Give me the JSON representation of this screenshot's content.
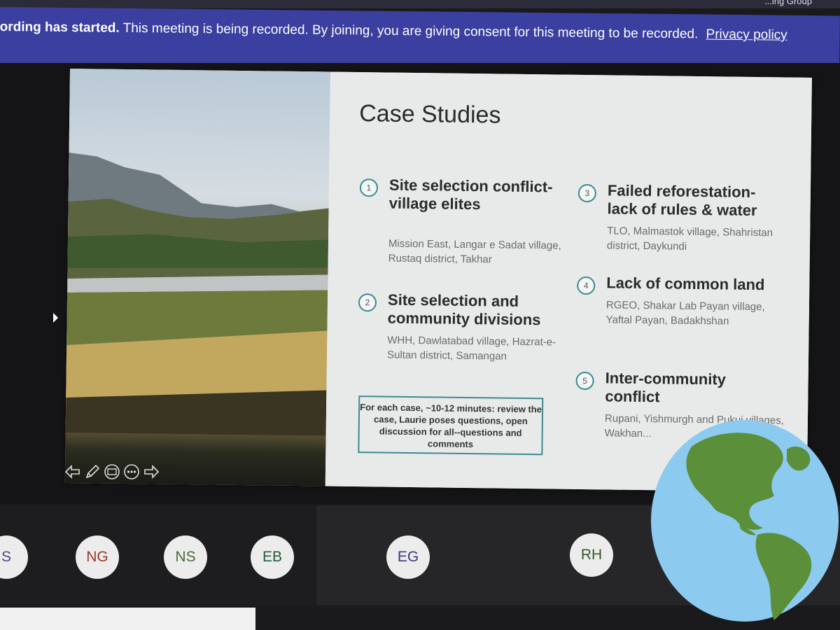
{
  "meeting": {
    "group_label": "...ing Group",
    "recording_banner": {
      "bold": "ording has started.",
      "message": "This meeting is being recorded. By joining, you are giving consent for this meeting to be recorded.",
      "link": "Privacy policy"
    }
  },
  "slide": {
    "title": "Case Studies",
    "cases": [
      {
        "number": "1",
        "title": "Site selection conflict- village elites",
        "subtitle": "Mission East, Langar e Sadat village, Rustaq district, Takhar"
      },
      {
        "number": "2",
        "title": "Site selection and community divisions",
        "subtitle": "WHH, Dawlatabad village, Hazrat-e-Sultan district, Samangan"
      },
      {
        "number": "3",
        "title": "Failed reforestation- lack of rules & water",
        "subtitle": "TLO, Malmastok village, Shahristan district, Daykundi"
      },
      {
        "number": "4",
        "title": "Lack of common land",
        "subtitle": "RGEO, Shakar Lab Payan village, Yaftal Payan, Badakhshan"
      },
      {
        "number": "5",
        "title": "Inter-community conflict",
        "subtitle": "Rupani, Yishmurgh and Pukui villages, Wakhan..."
      }
    ],
    "note": "For each case, ~10-12 minutes: review the case, Laurie poses questions, open discussion for all--questions and comments"
  },
  "participants": [
    {
      "initials": "S",
      "color": "#4a4a8a"
    },
    {
      "initials": "NG",
      "color": "#9a3a2a"
    },
    {
      "initials": "NS",
      "color": "#4a6a3a"
    },
    {
      "initials": "EB",
      "color": "#2a5a3a"
    },
    {
      "initials": "EG",
      "color": "#3a3a7a"
    },
    {
      "initials": "RH",
      "color": "#3a5a2a"
    }
  ],
  "icons": [
    "prev-slide-arrow-icon",
    "pen-icon",
    "subtitle-icon",
    "more-options-icon",
    "next-slide-arrow-icon",
    "globe-icon"
  ]
}
